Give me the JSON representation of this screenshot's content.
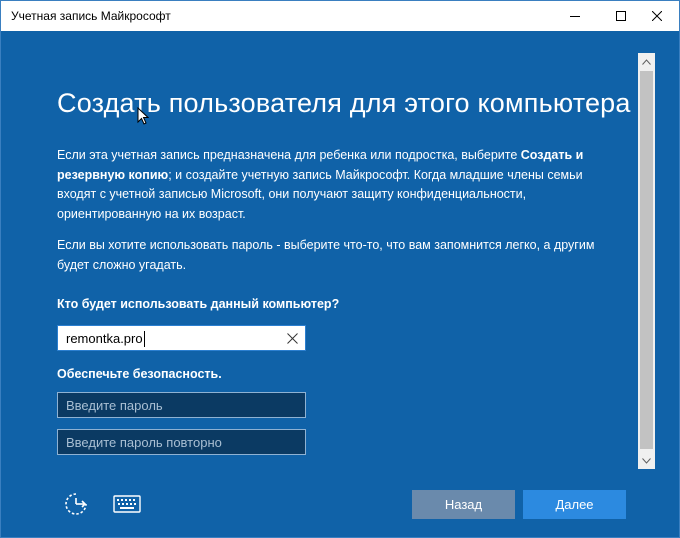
{
  "window": {
    "title": "Учетная запись Майкрософт"
  },
  "main": {
    "heading": "Создать пользователя для этого компьютера",
    "para1_pre": "Если эта учетная запись предназначена для ребенка или подростка, выберите ",
    "para1_bold": "Создать и резервную копию",
    "para1_post": "; и создайте учетную запись Майкрософт. Когда младшие члены семьи входят с учетной записью Microsoft, они получают защиту конфиденциальности, ориентированную на их возраст.",
    "para2": "Если вы хотите использовать пароль - выберите что-то, что вам запомнится легко, а другим будет сложно угадать.",
    "who_label": "Кто будет использовать данный компьютер?",
    "username_value": "remontka.pro",
    "security_label": "Обеспечьте безопасность.",
    "password_placeholder": "Введите пароль",
    "password_repeat_placeholder": "Введите пароль повторно"
  },
  "footer": {
    "back_label": "Назад",
    "next_label": "Далее"
  },
  "colors": {
    "background": "#1062a8",
    "next_button": "#2c8ae0",
    "back_button": "#6a8aac"
  }
}
